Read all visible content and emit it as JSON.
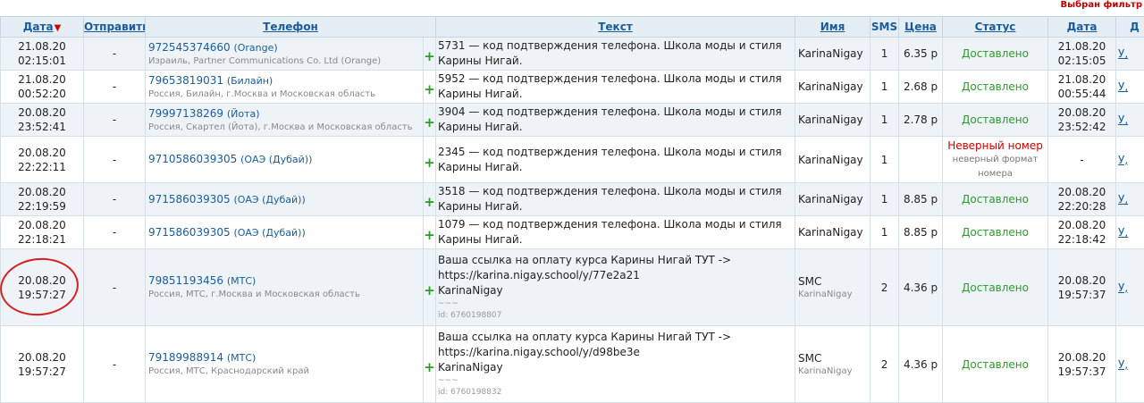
{
  "filter_note": "Выбран фильтр",
  "headers": {
    "date": "Дата",
    "send": "Отправить",
    "phone": "Телефон",
    "text": "Текст",
    "name": "Имя",
    "sms": "SMS",
    "price": "Цена",
    "status": "Статус",
    "sent_date": "Дата",
    "last": "Д"
  },
  "sort_arrow": "▼",
  "rows": [
    {
      "date": "21.08.20",
      "time": "02:15:01",
      "send": "-",
      "number": "972545374660",
      "operator": "(Orange)",
      "region": "Израиль, Partner Communications Co. Ltd (Orange)",
      "text": "5731 — код подтверждения телефона. Школа моды и стиля Карины Нигай.",
      "name": "KarinaNigay",
      "sms": "1",
      "price": "6.35 р",
      "status": "Доставлено",
      "sent_date": "21.08.20",
      "sent_time": "02:15:05",
      "last": "У,"
    },
    {
      "date": "21.08.20",
      "time": "00:52:20",
      "send": "-",
      "number": "79653819031",
      "operator": "(Билайн)",
      "region": "Россия, Билайн, г.Москва и Московская область",
      "text": "5952 — код подтверждения телефона. Школа моды и стиля Карины Нигай.",
      "name": "KarinaNigay",
      "sms": "1",
      "price": "2.68 р",
      "status": "Доставлено",
      "sent_date": "21.08.20",
      "sent_time": "00:55:44",
      "last": "У,"
    },
    {
      "date": "20.08.20",
      "time": "23:52:41",
      "send": "-",
      "number": "79997138269",
      "operator": "(Йота)",
      "region": "Россия, Скартел (Йота), г.Москва и Московская область",
      "text": "3904 — код подтверждения телефона. Школа моды и стиля Карины Нигай.",
      "name": "KarinaNigay",
      "sms": "1",
      "price": "2.78 р",
      "status": "Доставлено",
      "sent_date": "20.08.20",
      "sent_time": "23:52:42",
      "last": "У,"
    },
    {
      "date": "20.08.20",
      "time": "22:22:11",
      "send": "-",
      "number": "9710586039305",
      "operator": "(ОАЭ (Дубай))",
      "region": "",
      "text": "2345 — код подтверждения телефона. Школа моды и стиля Карины Нигай.",
      "name": "KarinaNigay",
      "sms": "1",
      "price": "",
      "status": "",
      "status_error": "Неверный номер",
      "status_error_sub": "неверный формат номера",
      "sent_date": "",
      "sent_time": "-",
      "last": "У,"
    },
    {
      "date": "20.08.20",
      "time": "22:19:59",
      "send": "-",
      "number": "971586039305",
      "operator": "(ОАЭ (Дубай))",
      "region": "",
      "text": "3518 — код подтверждения телефона. Школа моды и стиля Карины Нигай.",
      "name": "KarinaNigay",
      "sms": "1",
      "price": "8.85 р",
      "status": "Доставлено",
      "sent_date": "20.08.20",
      "sent_time": "22:20:28",
      "last": "У,"
    },
    {
      "date": "20.08.20",
      "time": "22:18:21",
      "send": "-",
      "number": "971586039305",
      "operator": "(ОАЭ (Дубай))",
      "region": "",
      "text": "1079 — код подтверждения телефона. Школа моды и стиля Карины Нигай.",
      "name": "KarinaNigay",
      "sms": "1",
      "price": "8.85 р",
      "status": "Доставлено",
      "sent_date": "20.08.20",
      "sent_time": "22:18:42",
      "last": "У,"
    },
    {
      "date": "20.08.20",
      "time": "19:57:27",
      "send": "-",
      "number": "79851193456",
      "operator": "(МТС)",
      "region": "Россия, МТС, г.Москва и Московская область",
      "text": "Ваша ссылка на оплату курса Карины Нигай ТУТ -> https://karina.nigay.school/y/77e2a21",
      "text_tail": "KarinaNigay",
      "tilde": "~~~",
      "msg_id": "id: 6760198807",
      "name": "SMC",
      "name_sub": "KarinaNigay",
      "sms": "2",
      "price": "4.36 р",
      "status": "Доставлено",
      "sent_date": "20.08.20",
      "sent_time": "19:57:37",
      "last": "У,"
    },
    {
      "date": "20.08.20",
      "time": "19:57:27",
      "send": "-",
      "number": "79189988914",
      "operator": "(МТС)",
      "region": "Россия, МТС, Краснодарский край",
      "text": "Ваша ссылка на оплату курса Карины Нигай ТУТ -> https://karina.nigay.school/y/d98be3e",
      "text_tail": "KarinaNigay",
      "tilde": "~~~",
      "msg_id": "id: 6760198832",
      "name": "SMC",
      "name_sub": "KarinaNigay",
      "sms": "2",
      "price": "4.36 р",
      "status": "Доставлено",
      "sent_date": "20.08.20",
      "sent_time": "19:57:37",
      "last": "У,"
    }
  ]
}
